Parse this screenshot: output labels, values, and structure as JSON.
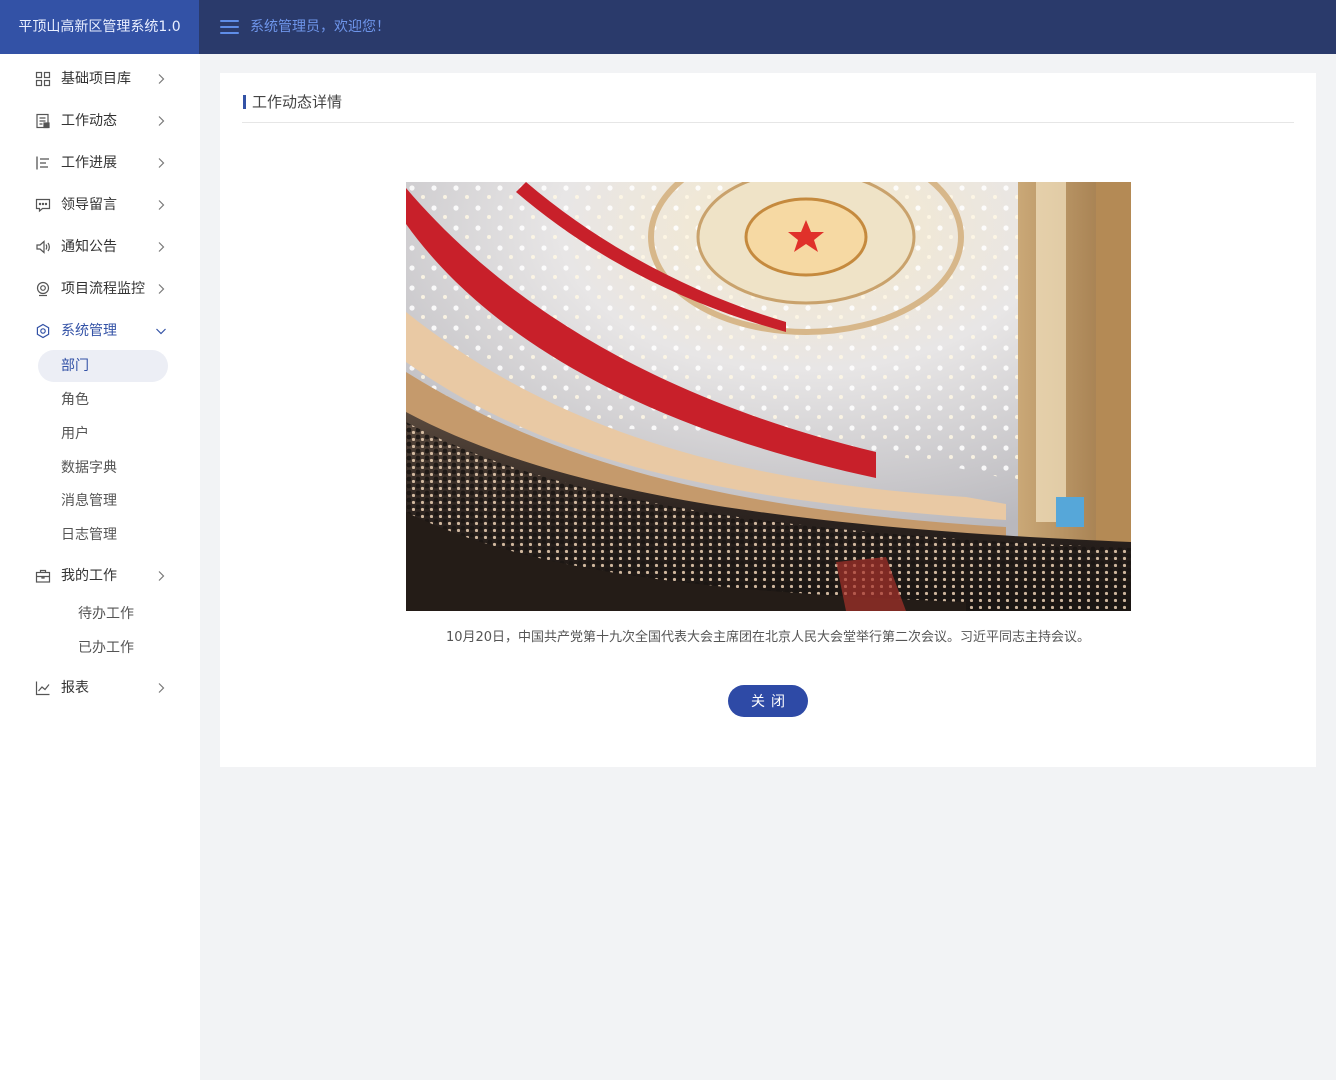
{
  "header": {
    "app_title": "平顶山高新区管理系统1.0",
    "welcome": "系统管理员，欢迎您！"
  },
  "sidebar": {
    "items": [
      {
        "label": "基础项目库",
        "icon": "grid-icon"
      },
      {
        "label": "工作动态",
        "icon": "document-icon"
      },
      {
        "label": "工作进展",
        "icon": "progress-list-icon"
      },
      {
        "label": "领导留言",
        "icon": "message-icon"
      },
      {
        "label": "通知公告",
        "icon": "speaker-icon"
      },
      {
        "label": "项目流程监控",
        "icon": "camera-icon"
      },
      {
        "label": "系统管理",
        "icon": "gear-icon",
        "expanded": true,
        "children": [
          "部门",
          "角色",
          "用户",
          "数据字典",
          "消息管理",
          "日志管理"
        ],
        "active_child": "部门"
      },
      {
        "label": "我的工作",
        "icon": "briefcase-icon",
        "children": [
          "待办工作",
          "已办工作"
        ]
      },
      {
        "label": "报表",
        "icon": "line-chart-icon"
      }
    ]
  },
  "main": {
    "title": "工作动态详情",
    "caption": "10月20日，中国共产党第十九次全国代表大会主席团在北京人民大会堂举行第二次会议。习近平同志主持会议。",
    "close_label": "关闭"
  },
  "colors": {
    "topbar": "#2a3a6b",
    "brand": "#3352a6",
    "accent": "#3352a6",
    "button": "#2e4aa6",
    "banner_red": "#c8202a"
  }
}
